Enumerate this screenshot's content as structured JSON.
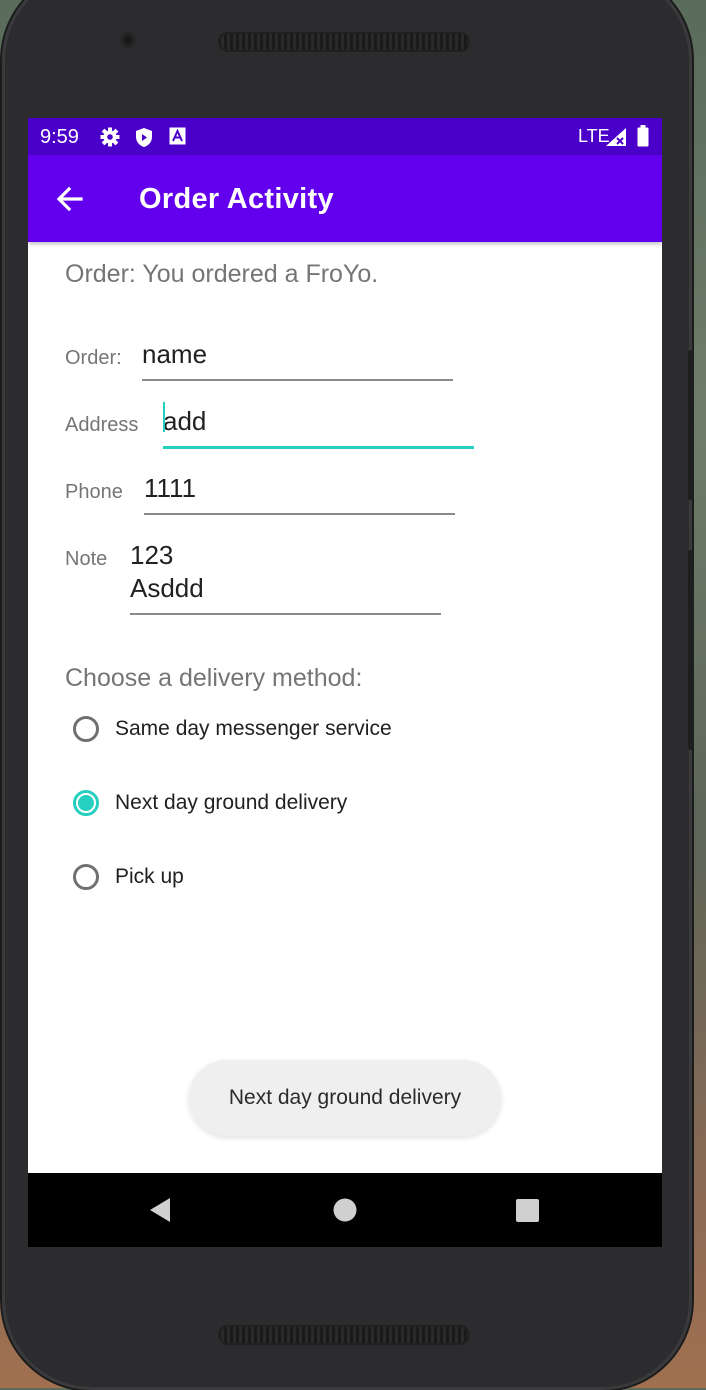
{
  "status_bar": {
    "time": "9:59",
    "network": "LTE",
    "icons": [
      "gear-icon",
      "shield-play-icon",
      "font-a-icon",
      "signal-icon",
      "battery-icon"
    ]
  },
  "app_bar": {
    "title": "Order Activity",
    "background": "#6200ee",
    "status_background": "#4a00c8"
  },
  "order_heading": "Order: You ordered a FroYo.",
  "form": {
    "order_label": "Order:",
    "order_value": "name",
    "address_label": "Address",
    "address_value": "add",
    "phone_label": "Phone",
    "phone_value": "1111",
    "note_label": "Note",
    "note_value": "123\nAsddd"
  },
  "delivery": {
    "heading": "Choose a delivery method:",
    "options": [
      {
        "label": "Same day messenger service",
        "checked": false
      },
      {
        "label": "Next day ground delivery",
        "checked": true
      },
      {
        "label": "Pick up",
        "checked": false
      }
    ]
  },
  "toast": "Next day ground delivery",
  "accent_color": "#26d0c0"
}
